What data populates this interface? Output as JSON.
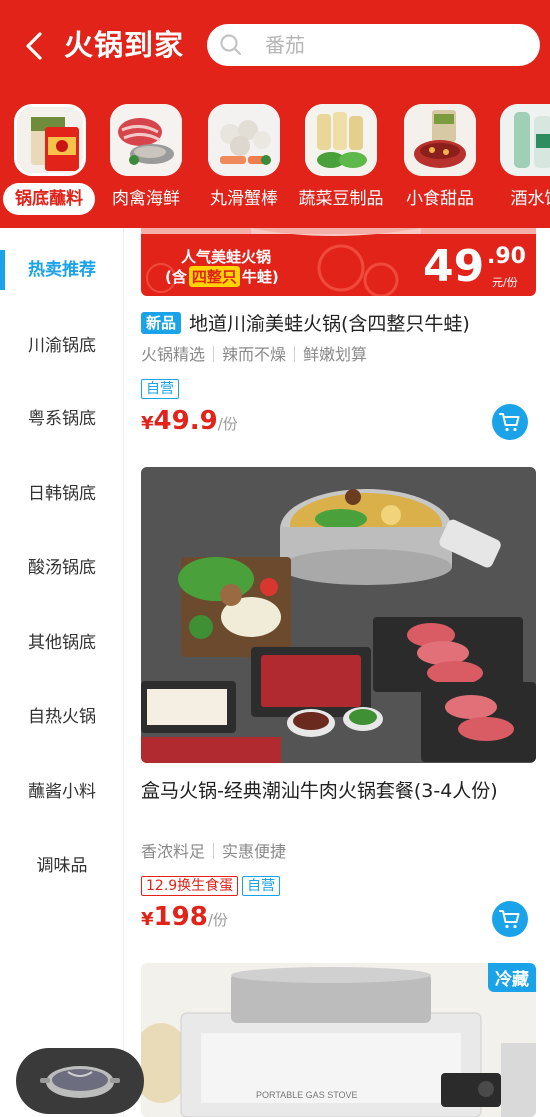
{
  "header": {
    "title": "火锅到家",
    "search_placeholder": "番茄",
    "brand_color": "#e2231a"
  },
  "categories": [
    {
      "label": "锅底蘸料",
      "active": true
    },
    {
      "label": "肉禽海鲜",
      "active": false
    },
    {
      "label": "丸滑蟹棒",
      "active": false
    },
    {
      "label": "蔬菜豆制品",
      "active": false
    },
    {
      "label": "小食甜品",
      "active": false
    },
    {
      "label": "酒水饮",
      "active": false
    }
  ],
  "sidebar": {
    "items": [
      {
        "label": "热卖推荐",
        "active": true
      },
      {
        "label": "川渝锅底",
        "active": false
      },
      {
        "label": "粤系锅底",
        "active": false
      },
      {
        "label": "日韩锅底",
        "active": false
      },
      {
        "label": "酸汤锅底",
        "active": false
      },
      {
        "label": "其他锅底",
        "active": false
      },
      {
        "label": "自热火锅",
        "active": false
      },
      {
        "label": "蘸酱小料",
        "active": false
      },
      {
        "label": "调味品",
        "active": false
      }
    ],
    "accent_color": "#1aa3e8"
  },
  "products": [
    {
      "promo_line1": "人气美蛙火锅",
      "promo_line2_pre": "(含",
      "promo_line2_highlight": "四整只",
      "promo_line2_post": "牛蛙)",
      "promo_price_int": "49",
      "promo_price_dec": ".90",
      "promo_unit": "元/份",
      "new_tag": "新品",
      "title": "地道川渝美蛙火锅(含四整只牛蛙)",
      "features": [
        "火锅精选",
        "辣而不燥",
        "鲜嫩划算"
      ],
      "badges": [
        "自营"
      ],
      "price_symbol": "¥",
      "price": "49.9",
      "price_unit": "/份"
    },
    {
      "title": "盒马火锅-经典潮汕牛肉火锅套餐(3-4人份)",
      "features": [
        "香浓料足",
        "实惠便捷"
      ],
      "promo_badge": "12.9换生食蛋",
      "badges": [
        "自营"
      ],
      "price_symbol": "¥",
      "price": "198",
      "price_unit": "/份"
    },
    {
      "corner_badge": "冷藏",
      "stove_label": "PORTABLE GAS STOVE"
    }
  ],
  "icons": {
    "back": "chevron-left-icon",
    "search": "search-icon",
    "cart": "cart-icon",
    "float": "hotpot-icon"
  }
}
